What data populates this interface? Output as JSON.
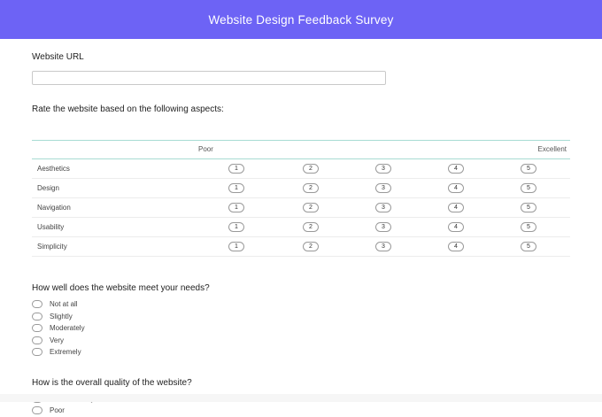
{
  "header": {
    "title": "Website Design Feedback Survey"
  },
  "url_field": {
    "label": "Website URL",
    "value": "",
    "placeholder": ""
  },
  "rating": {
    "prompt": "Rate the website based on the following aspects:",
    "scale_low": "Poor",
    "scale_high": "Excellent",
    "scale": [
      "1",
      "2",
      "3",
      "4",
      "5"
    ],
    "rows": [
      "Aesthetics",
      "Design",
      "Navigation",
      "Usability",
      "Simplicity"
    ]
  },
  "needs": {
    "question": "How well does the website meet your needs?",
    "options": [
      "Not at all",
      "Slightly",
      "Moderately",
      "Very",
      "Extremely"
    ]
  },
  "quality": {
    "question": "How is the overall quality of the website?",
    "options": [
      "Unsatisfactory",
      "Poor"
    ]
  },
  "colors": {
    "header_bg": "#6d63f5",
    "divider": "#a8dcd3"
  }
}
